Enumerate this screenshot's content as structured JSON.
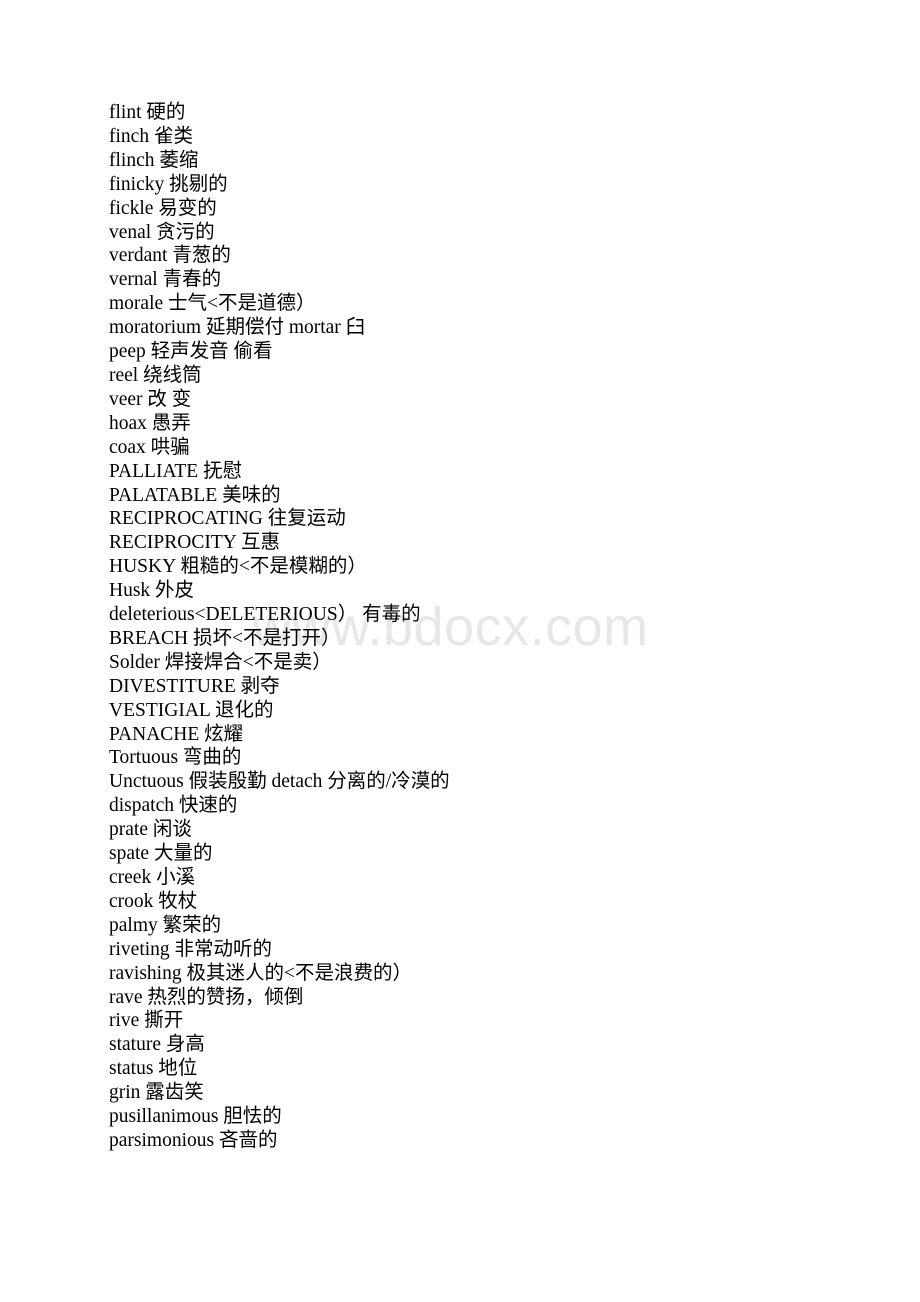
{
  "document": {
    "background_color": "#ffffff",
    "text_color": "#000000",
    "watermark": {
      "text": "www.bdocx.com",
      "color": "#e7e7e7"
    },
    "lines": [
      "flint 硬的",
      "finch 雀类",
      "flinch 萎缩",
      "finicky 挑剔的",
      "fickle 易变的",
      "venal 贪污的",
      "verdant 青葱的",
      "vernal 青春的",
      "morale 士气<不是道德）",
      "moratorium 延期偿付 mortar 臼",
      "peep 轻声发音 偷看",
      "reel 绕线筒",
      "veer 改 变",
      "hoax 愚弄",
      "coax 哄骗",
      "PALLIATE 抚慰",
      "PALATABLE 美味的",
      "RECIPROCATING 往复运动",
      "RECIPROCITY 互惠",
      "HUSKY 粗糙的<不是模糊的）",
      "Husk 外皮",
      "deleterious<DELETERIOUS） 有毒的",
      "BREACH 损坏<不是打开）",
      "Solder 焊接焊合<不是卖）",
      "DIVESTITURE 剥夺",
      "VESTIGIAL 退化的",
      "PANACHE 炫耀",
      "Tortuous 弯曲的",
      "Unctuous 假装殷勤 detach 分离的/冷漠的",
      "dispatch 快速的",
      "prate 闲谈",
      "spate 大量的",
      "creek 小溪",
      "crook 牧杖",
      "palmy 繁荣的",
      "riveting 非常动听的",
      "ravishing 极其迷人的<不是浪费的）",
      "rave 热烈的赞扬，倾倒",
      "rive 撕开",
      "stature 身高",
      "status 地位",
      "grin 露齿笑",
      "pusillanimous 胆怯的",
      "parsimonious 吝啬的"
    ]
  }
}
